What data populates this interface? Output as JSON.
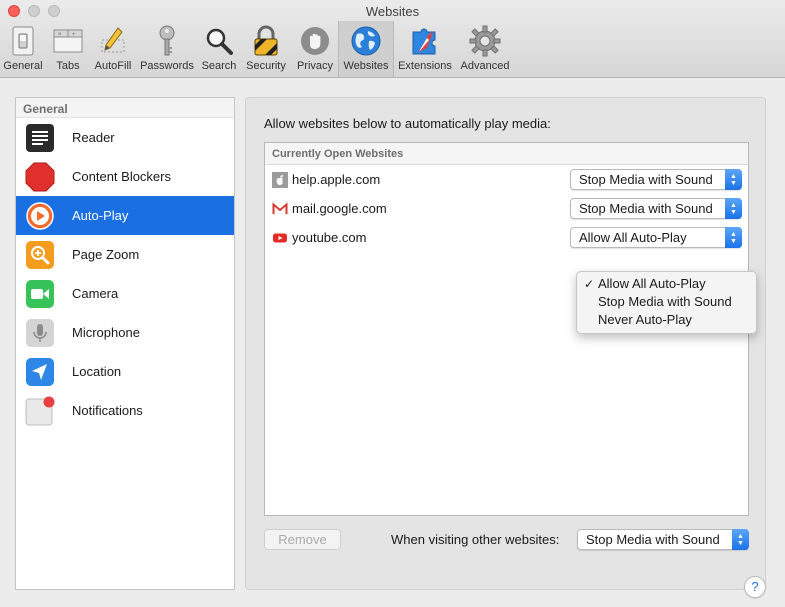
{
  "window": {
    "title": "Websites"
  },
  "toolbar": {
    "items": [
      {
        "label": "General",
        "icon": "general-switch-icon"
      },
      {
        "label": "Tabs",
        "icon": "tabs-icon"
      },
      {
        "label": "AutoFill",
        "icon": "autofill-pencil-icon"
      },
      {
        "label": "Passwords",
        "icon": "key-icon"
      },
      {
        "label": "Search",
        "icon": "magnifier-icon"
      },
      {
        "label": "Security",
        "icon": "padlock-icon"
      },
      {
        "label": "Privacy",
        "icon": "hand-icon"
      },
      {
        "label": "Websites",
        "icon": "globe-icon",
        "active": true
      },
      {
        "label": "Extensions",
        "icon": "puzzle-compass-icon"
      },
      {
        "label": "Advanced",
        "icon": "gear-icon"
      }
    ]
  },
  "sidebar": {
    "header": "General",
    "items": [
      {
        "label": "Reader",
        "icon": "reader-icon"
      },
      {
        "label": "Content Blockers",
        "icon": "stop-sign-icon"
      },
      {
        "label": "Auto-Play",
        "icon": "play-icon",
        "selected": true
      },
      {
        "label": "Page Zoom",
        "icon": "zoom-icon"
      },
      {
        "label": "Camera",
        "icon": "camera-icon"
      },
      {
        "label": "Microphone",
        "icon": "microphone-icon"
      },
      {
        "label": "Location",
        "icon": "location-arrow-icon"
      },
      {
        "label": "Notifications",
        "icon": "notifications-icon"
      }
    ]
  },
  "main": {
    "description": "Allow websites below to automatically play media:",
    "list_header": "Currently Open Websites",
    "sites": [
      {
        "name": "help.apple.com",
        "icon": "apple-icon",
        "setting": "Stop Media with Sound"
      },
      {
        "name": "mail.google.com",
        "icon": "gmail-icon",
        "setting": "Stop Media with Sound"
      },
      {
        "name": "youtube.com",
        "icon": "youtube-icon",
        "setting": "Allow All Auto-Play"
      }
    ],
    "menu": {
      "options": [
        "Allow All Auto-Play",
        "Stop Media with Sound",
        "Never Auto-Play"
      ],
      "checked": "Allow All Auto-Play"
    },
    "remove_label": "Remove",
    "other_label": "When visiting other websites:",
    "other_value": "Stop Media with Sound"
  },
  "help_label": "?",
  "colors": {
    "accent": "#1a6fe3",
    "close": "#fc605c"
  }
}
